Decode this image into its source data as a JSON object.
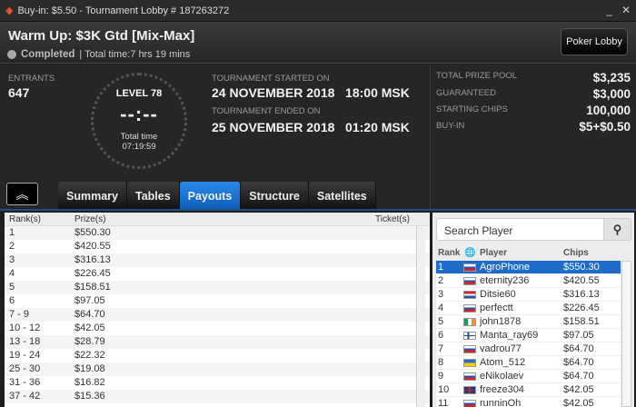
{
  "window": {
    "title": "Buy-in: $5.50 - Tournament Lobby # 187263272",
    "minimize": "_",
    "close": "✕"
  },
  "header": {
    "title": "Warm Up: $3K Gtd [Mix-Max]",
    "status": "Completed",
    "total_time": "| Total time:7 hrs  19 mins",
    "lobby_button": "Poker Lobby"
  },
  "info": {
    "entrants_label": "ENTRANTS",
    "entrants": "647",
    "level": "LEVEL 78",
    "timer": "--:--",
    "total_time_label": "Total time",
    "total_time": "07:19:59",
    "started_label": "TOURNAMENT STARTED ON",
    "started": "24 NOVEMBER 2018   18:00 MSK",
    "ended_label": "TOURNAMENT ENDED ON",
    "ended": "25 NOVEMBER 2018   01:20 MSK",
    "stats": [
      {
        "label": "TOTAL PRIZE POOL",
        "value": "$3,235"
      },
      {
        "label": "GUARANTEED",
        "value": "$3,000"
      },
      {
        "label": "STARTING CHIPS",
        "value": "100,000"
      },
      {
        "label": "BUY-IN",
        "value": "$5+$0.50"
      }
    ]
  },
  "tabs": [
    {
      "label": "Summary"
    },
    {
      "label": "Tables"
    },
    {
      "label": "Payouts",
      "active": true
    },
    {
      "label": "Structure"
    },
    {
      "label": "Satellites"
    }
  ],
  "payouts": {
    "columns": [
      "Rank(s)",
      "Prize(s)",
      "Ticket(s)"
    ],
    "rows": [
      [
        "1",
        "$550.30"
      ],
      [
        "2",
        "$420.55"
      ],
      [
        "3",
        "$316.13"
      ],
      [
        "4",
        "$226.45"
      ],
      [
        "5",
        "$158.51"
      ],
      [
        "6",
        "$97.05"
      ],
      [
        "7 - 9",
        "$64.70"
      ],
      [
        "10 - 12",
        "$42.05"
      ],
      [
        "13 - 18",
        "$28.79"
      ],
      [
        "19 - 24",
        "$22.32"
      ],
      [
        "25 - 30",
        "$19.08"
      ],
      [
        "31 - 36",
        "$16.82"
      ],
      [
        "37 - 42",
        "$15.36"
      ]
    ]
  },
  "players": {
    "search_placeholder": "Search Player",
    "columns": [
      "Rank",
      "Player",
      "Chips"
    ],
    "rows": [
      {
        "rank": "1",
        "player": "AgroPhone",
        "chips": "$550.30",
        "flag": "russia"
      },
      {
        "rank": "2",
        "player": "eternity236",
        "chips": "$420.55",
        "flag": "russia"
      },
      {
        "rank": "3",
        "player": "Ditsie60",
        "chips": "$316.13",
        "flag": "netherlands"
      },
      {
        "rank": "4",
        "player": "perfectt",
        "chips": "$226.45",
        "flag": "russia"
      },
      {
        "rank": "5",
        "player": "john1878",
        "chips": "$158.51",
        "flag": "ireland"
      },
      {
        "rank": "6",
        "player": "Manta_ray69",
        "chips": "$97.05",
        "flag": "finland"
      },
      {
        "rank": "7",
        "player": "vadrou77",
        "chips": "$64.70",
        "flag": "russia"
      },
      {
        "rank": "8",
        "player": "Atom_512",
        "chips": "$64.70",
        "flag": "ukraine"
      },
      {
        "rank": "9",
        "player": "eNikolaev",
        "chips": "$64.70",
        "flag": "russia"
      },
      {
        "rank": "10",
        "player": "freeze304",
        "chips": "$42.05",
        "flag": "uk"
      },
      {
        "rank": "11",
        "player": "runninOh",
        "chips": "$42.05",
        "flag": "russia"
      }
    ]
  },
  "colors": {
    "accent": "#1f6bc9",
    "brand": "#e8522a"
  }
}
